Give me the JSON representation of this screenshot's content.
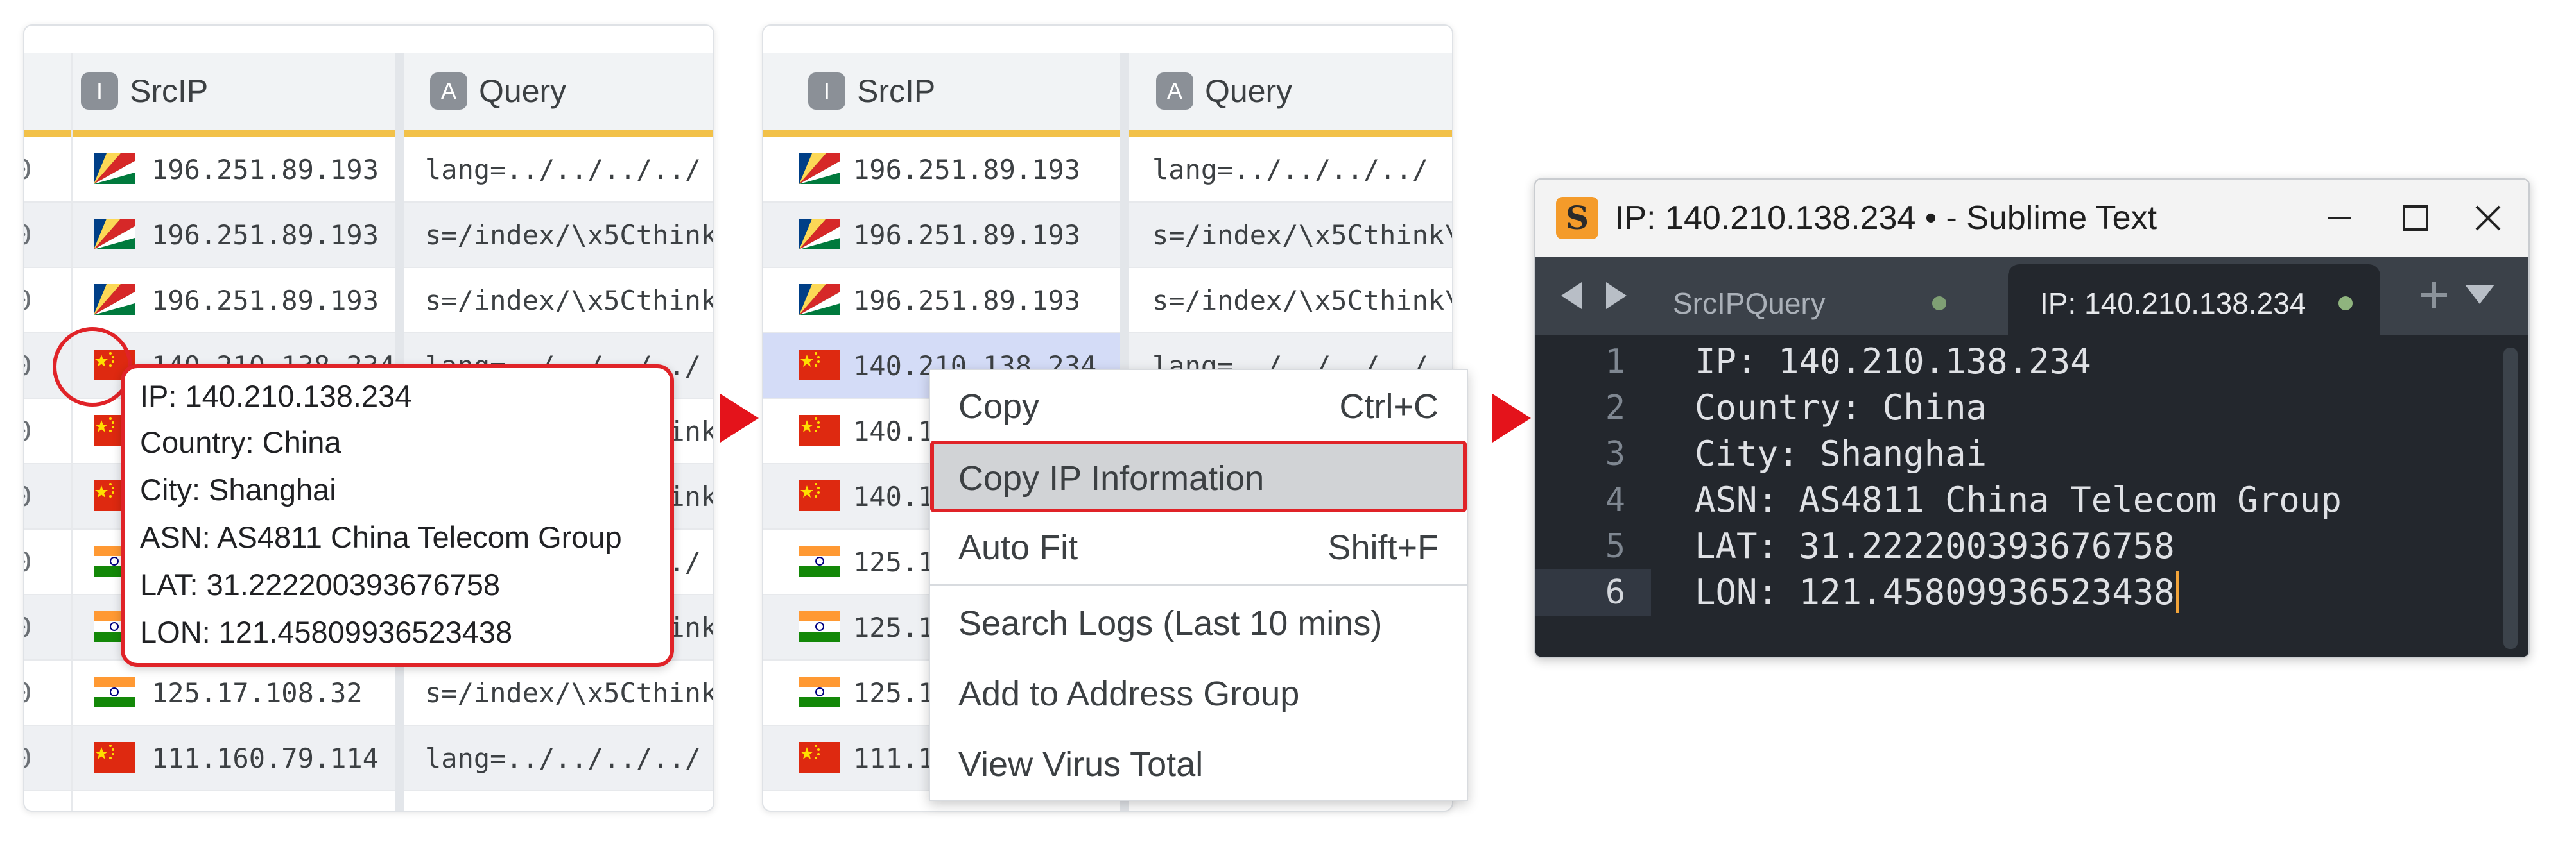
{
  "table": {
    "columns": [
      {
        "badge": "I",
        "label": "SrcIP"
      },
      {
        "badge": "A",
        "label": "Query"
      }
    ],
    "leading_digit": "0",
    "rows": [
      {
        "flag": "seychelles",
        "ip": "196.251.89.193",
        "query": "lang=../../../../",
        "query_full": "lang=../../../../"
      },
      {
        "flag": "seychelles",
        "ip": "196.251.89.193",
        "query": "s=/index/\\x5Cthink",
        "query_full": "s=/index/\\x5Cthink\\x"
      },
      {
        "flag": "seychelles",
        "ip": "196.251.89.193",
        "query": "s=/index/\\x5Cthink",
        "query_full": "s=/index/\\x5Cthink\\x"
      },
      {
        "flag": "china",
        "ip": "140.210.138.234",
        "query": "lang=../../../../",
        "query_full": "lang=../../../../"
      },
      {
        "flag": "china",
        "ip": "140.210.138.234",
        "query": "s=/index/\\x5Cthink",
        "query_full": "s=/index/\\x5Cthink\\x"
      },
      {
        "flag": "china",
        "ip": "140.210.138.234",
        "query": "s=/index/\\x5Cthink",
        "query_full": "s=/index/\\x5Cthink\\x"
      },
      {
        "flag": "india",
        "ip": "125.17.108.32",
        "query": "lang=../../../../",
        "query_full": "lang=../../../../"
      },
      {
        "flag": "india",
        "ip": "125.17.108.32",
        "query": "s=/index/\\x5Cthink",
        "query_full": "s=/index/\\x5Cthink\\x"
      },
      {
        "flag": "india",
        "ip": "125.17.108.32",
        "query": "s=/index/\\x5Cthink",
        "query_full": "s=/index/\\x5Cthink\\x"
      },
      {
        "flag": "china",
        "ip": "111.160.79.114",
        "query": "lang=../../../../",
        "query_full": "lang=../../../../"
      }
    ],
    "panel2_partial_ips": [
      "140.1",
      "140.1",
      "125.1",
      "125.1",
      "125.1",
      "111.1"
    ],
    "panel2_partial_queries": [
      "x",
      "x",
      "/",
      "x",
      "x",
      "/"
    ]
  },
  "tooltip": {
    "lines": [
      "IP: 140.210.138.234",
      "Country: China",
      "City: Shanghai",
      "ASN: AS4811 China Telecom Group",
      "LAT: 31.222200393676758",
      "LON: 121.45809936523438"
    ]
  },
  "context_menu": {
    "items": [
      {
        "label": "Copy",
        "shortcut": "Ctrl+C"
      },
      {
        "label": "Copy IP Information",
        "shortcut": ""
      },
      {
        "label": "Auto Fit",
        "shortcut": "Shift+F"
      },
      {
        "label": "Search Logs (Last 10 mins)",
        "shortcut": ""
      },
      {
        "label": "Add to Address Group",
        "shortcut": ""
      },
      {
        "label": "View Virus Total",
        "shortcut": ""
      }
    ],
    "highlighted": "Copy IP Information"
  },
  "editor": {
    "app_logo": "S",
    "window_title": "IP: 140.210.138.234 • - Sublime Text",
    "tabs": [
      {
        "label": "SrcIPQuery",
        "active": false
      },
      {
        "label": "IP: 140.210.138.234",
        "active": true
      }
    ],
    "current_line": 6,
    "lines": [
      "IP: 140.210.138.234",
      "Country: China",
      "City: Shanghai",
      "ASN: AS4811 China Telecom Group",
      "LAT: 31.222200393676758",
      "LON: 121.45809936523438"
    ],
    "line_numbers": [
      "1",
      "2",
      "3",
      "4",
      "5",
      "6"
    ]
  },
  "colors": {
    "accent_red": "#e02328",
    "header_underline": "#f2c149",
    "selected_row": "#d4dcf7",
    "sublime_bg": "#23272d"
  }
}
